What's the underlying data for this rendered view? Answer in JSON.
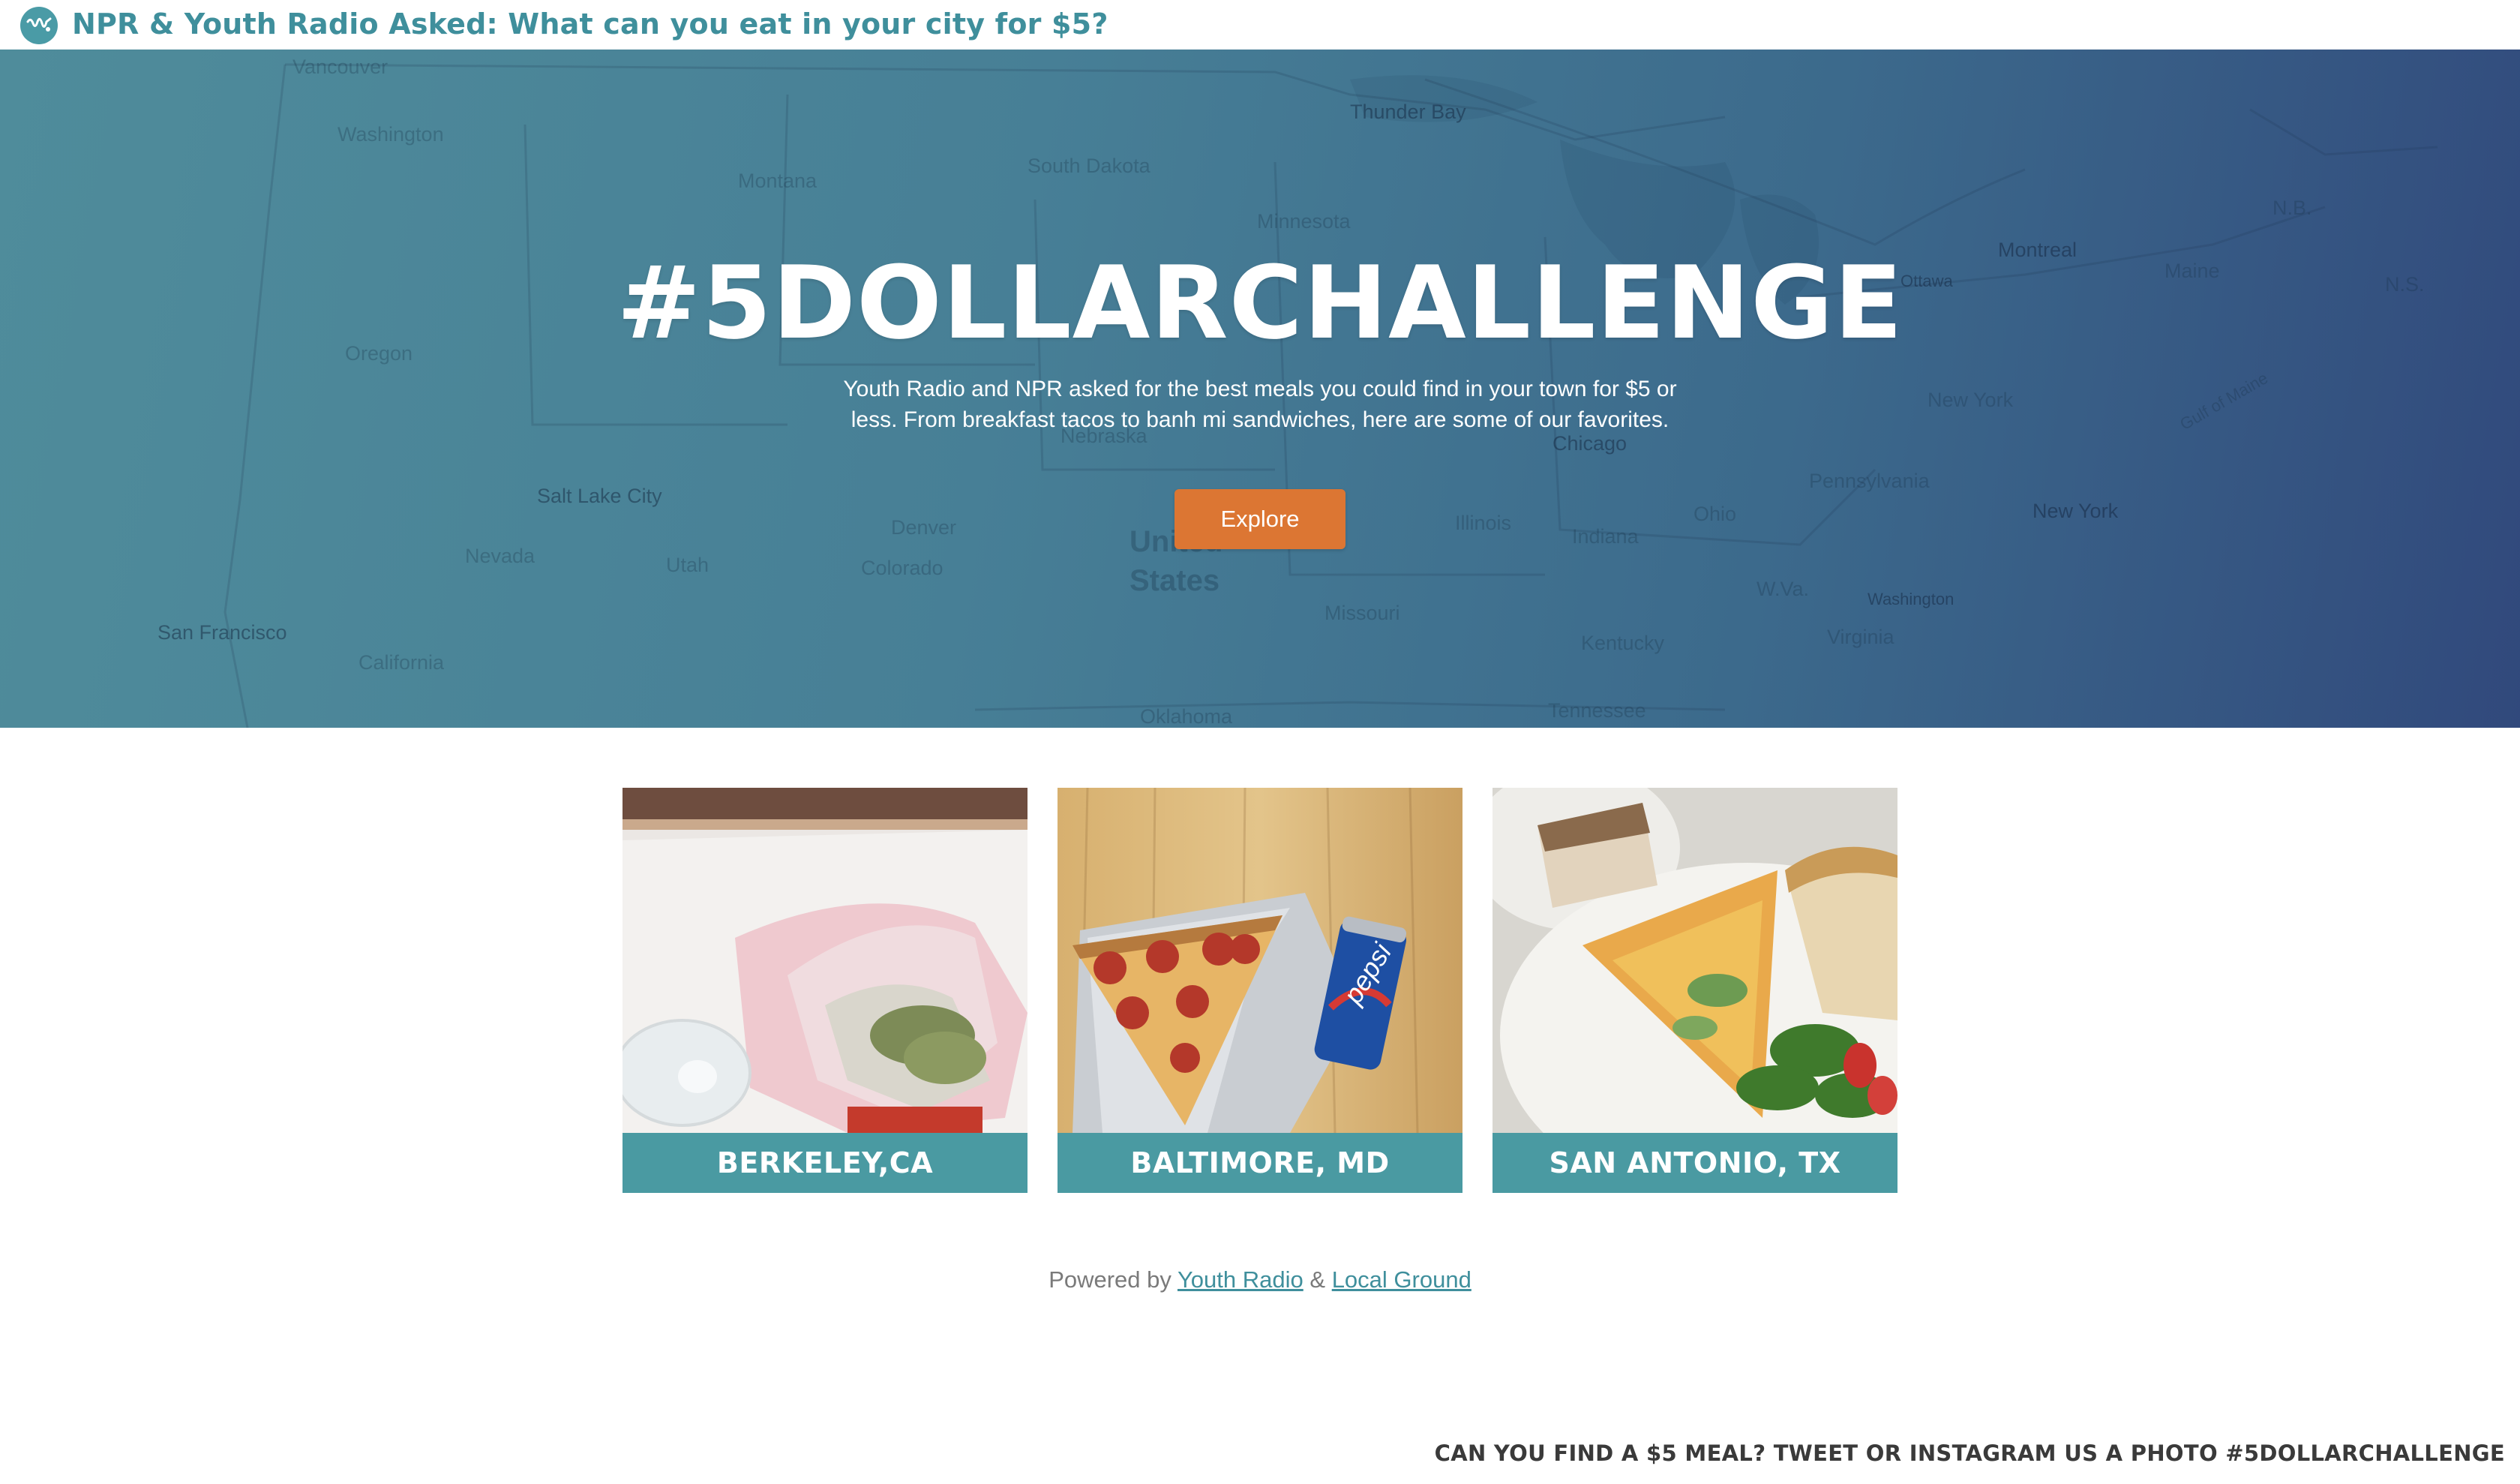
{
  "header": {
    "logo_icon": "youth-radio-logo-icon",
    "title": "NPR & Youth Radio Asked: What can you eat in your city for $5?"
  },
  "hero": {
    "title": "#5DOLLARCHALLENGE",
    "description": "Youth Radio and NPR asked for the best meals you could find in your town for $5 or less. From breakfast tacos to banh mi sandwiches, here are some of our favorites.",
    "button_label": "Explore",
    "button_color": "#dc7633",
    "map_labels": [
      "Vancouver",
      "Washington",
      "Thunder Bay",
      "Montreal",
      "Ottawa",
      "Salt Lake City",
      "San Francisco",
      "Denver",
      "Chicago",
      "New York",
      "New York",
      "Washington",
      "United",
      "States",
      "Oklahoma",
      "Tennessee",
      "Kentucky",
      "Virginia",
      "Ohio",
      "Missouri",
      "Pennsylvania",
      "Nevada",
      "Oregon",
      "Colorado",
      "Nebraska",
      "South Dakota",
      "Minnesota",
      "Illinois",
      "Indiana",
      "Utah",
      "California",
      "Montana",
      "Maine",
      "N.B.",
      "N.S.",
      "Gulf of Maine",
      "W.Va."
    ]
  },
  "cards": [
    {
      "city": "BERKELEY,CA",
      "photo": "burrito-photo"
    },
    {
      "city": "BALTIMORE, MD",
      "photo": "pizza-and-pepsi-photo"
    },
    {
      "city": "SAN ANTONIO, TX",
      "photo": "quiche-plate-photo"
    }
  ],
  "footer": {
    "powered_prefix": "Powered by",
    "link1": "Youth Radio",
    "amp": "&",
    "link2": "Local Ground",
    "cta": "CAN YOU FIND A $5 MEAL? TWEET OR INSTAGRAM US A PHOTO #5DOLLARCHALLENGE"
  },
  "colors": {
    "brand_teal": "#3f8f9c",
    "caption_teal": "#4a9aa2",
    "hero_start": "#4f8c9b",
    "hero_end": "#31497c"
  }
}
